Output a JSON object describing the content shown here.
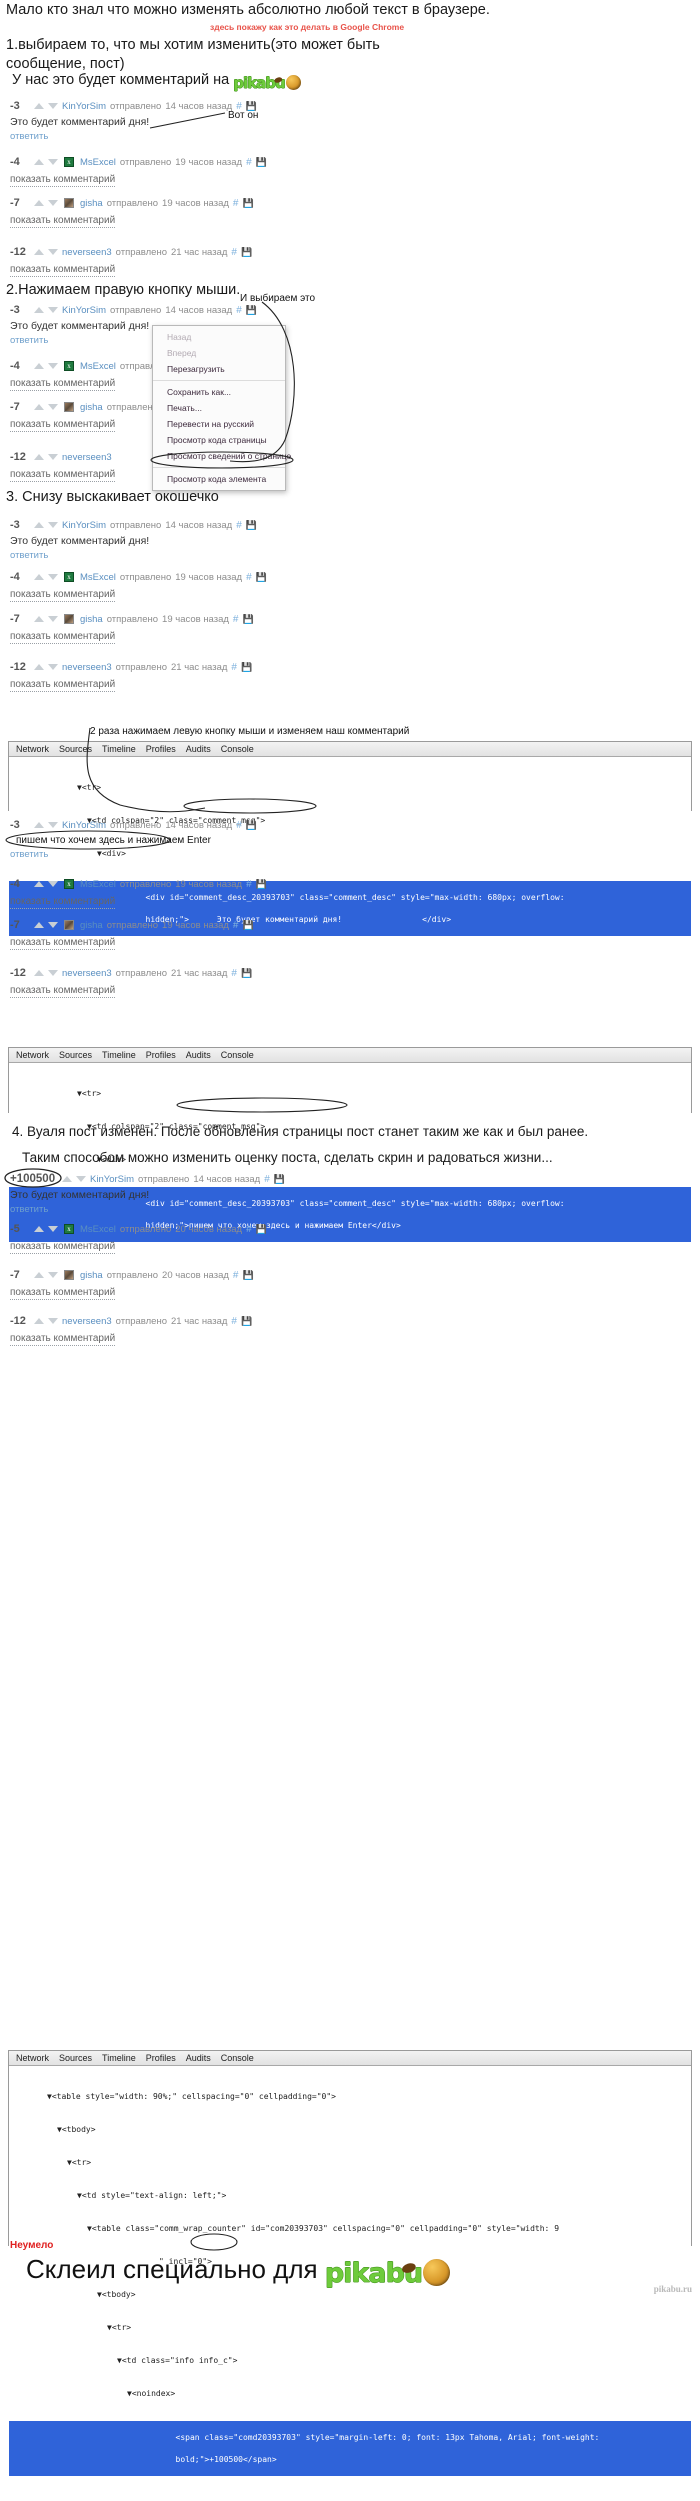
{
  "headline": "Мало кто знал что можно изменять абсолютно любой текст в браузере.",
  "subhead": "здесь покажу как это делать в Google Chrome",
  "steps": {
    "s1": "1.выбираем то, что мы хотим изменить(это может быть сообщение, пост)",
    "s1b": "У нас это будет комментарий на",
    "s2": "2.Нажимаем правую кнопку мыши.",
    "s3": "3. Снизу выскакивает окошечко",
    "s4": "4. Вуаля пост изменен. После обновления страницы пост станет таким же как и был ранее.",
    "s4b": "Таким способом можно изменить оценку поста, сделать скрин и радоваться жизни..."
  },
  "annotations": {
    "vot_on": "Вот он",
    "i_vybiraem": "И выбираем это",
    "dvarazha": "2 раза нажимаем левую кнопку мыши и изменяем наш комментарий",
    "pishem": "пишем что хочем здесь и нажимаем Enter"
  },
  "labels": {
    "reply": "ответить",
    "show_comment": "показать комментарий",
    "sent": "отправлено",
    "hash": "#",
    "save_icon": "save-icon"
  },
  "comment_text_1": "Это будет комментарий дня!",
  "brand": "pikabu",
  "thread_1": [
    {
      "score": "-3",
      "user": "KinYorSim",
      "time": "14 часов назад",
      "avatar": "none",
      "body": "Это будет комментарий дня!",
      "action": "ответить"
    },
    {
      "score": "-4",
      "user": "MsExcel",
      "time": "19 часов назад",
      "avatar": "excel",
      "body": "",
      "action": "показать комментарий"
    },
    {
      "score": "-7",
      "user": "gisha",
      "time": "19 часов назад",
      "avatar": "photo",
      "body": "",
      "action": "показать комментарий"
    },
    {
      "score": "-12",
      "user": "neverseen3",
      "time": "21 час назад",
      "avatar": "none",
      "body": "",
      "action": "показать комментарий"
    }
  ],
  "thread_4": [
    {
      "score": "+100500",
      "user": "KinYorSim",
      "time": "14 часов назад",
      "avatar": "none",
      "body": "Это будет комментарий дня!",
      "action": "ответить"
    },
    {
      "score": "-5",
      "user": "MsExcel",
      "time": "20 часов назад",
      "avatar": "excel",
      "body": "",
      "action": "показать комментарий"
    },
    {
      "score": "-7",
      "user": "gisha",
      "time": "20 часов назад",
      "avatar": "photo",
      "body": "",
      "action": "показать комментарий"
    },
    {
      "score": "-12",
      "user": "neverseen3",
      "time": "21 час назад",
      "avatar": "none",
      "body": "",
      "action": "показать комментарий"
    }
  ],
  "context_menu": [
    {
      "label": "Назад",
      "disabled": true
    },
    {
      "label": "Вперед",
      "disabled": true
    },
    {
      "label": "Перезагрузить",
      "disabled": false
    },
    {
      "label": "Сохранить как...",
      "disabled": false
    },
    {
      "label": "Печать...",
      "disabled": false
    },
    {
      "label": "Перевести на русский",
      "disabled": false
    },
    {
      "label": "Просмотр кода страницы",
      "disabled": false
    },
    {
      "label": "Просмотр  сведений о странице",
      "disabled": false
    },
    {
      "label": "Просмотр кода элемента",
      "disabled": false
    }
  ],
  "devtools_tabs": [
    "Network",
    "Sources",
    "Timeline",
    "Profiles",
    "Audits",
    "Console"
  ],
  "devtools_1": {
    "l1": "▼<tr>",
    "l2": "▼<td colspan=\"2\" class=\"comment_msg\">",
    "l3": "▼<div>",
    "l4a": "<div id=\"comment_desc_20393703\" class=\"comment_desc\" style=\"max-width: 680px; overflow:",
    "l4b": "hidden;\">",
    "l4c": "Это будет комментарий дня!",
    "l4d": "</div>"
  },
  "devtools_2": {
    "l1": "▼<tr>",
    "l2": "▼<td colspan=\"2\" class=\"comment_msg\">",
    "l3": "▼<div>",
    "l4a": "<div id=\"comment_desc_20393703\" class=\"comment_desc\" style=\"max-width: 680px; overflow:",
    "l4b": "hidden;\">пишем что хочем здесь и нажимаем Enter</div>"
  },
  "devtools_3": {
    "l1": "▼<table style=\"width: 90%;\" cellspacing=\"0\" cellpadding=\"0\">",
    "l2": "▼<tbody>",
    "l3": "▼<tr>",
    "l4": "▼<td style=\"text-align: left;\">",
    "l5": "▼<table class=\"comm_wrap_counter\" id=\"com20393703\" cellspacing=\"0\" cellpadding=\"0\" style=\"width: 9",
    "l6": "\" incl=\"0\">",
    "l7": "▼<tbody>",
    "l8": "▼<tr>",
    "l9": "▼<td class=\"info info_c\">",
    "l10": "▼<noindex>",
    "l11a": "<span class=\"comd20393703\" style=\"margin-left: 0; font: 13px Tahoma, Arial; font-weight:",
    "l11b": "bold;\">",
    "l11c": "+100500",
    "l11d": "</span>"
  },
  "footer": {
    "label": "Неумело",
    "text": "Склеил специально для",
    "watermark": "pikabu.ru"
  }
}
